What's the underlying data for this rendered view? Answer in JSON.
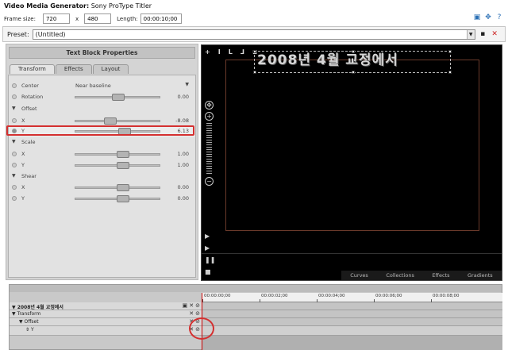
{
  "window": {
    "title_bold": "Video Media Generator:",
    "title_rest": " Sony ProType Titler"
  },
  "framebar": {
    "frame_size_label": "Frame size:",
    "width": "720",
    "x_label": "x",
    "height": "480",
    "length_label": "Length:",
    "length": "00:00:10;00"
  },
  "preset": {
    "label": "Preset:",
    "value": "(Untitled)"
  },
  "panel": {
    "title": "Text Block Properties",
    "tabs": [
      "Transform",
      "Effects",
      "Layout"
    ]
  },
  "props": {
    "center_label": "Center",
    "center_value": "Near baseline",
    "rotation_label": "Rotation",
    "rotation_value": "0.00",
    "offset_label": "Offset",
    "offset_x_label": "X",
    "offset_x_value": "-8.08",
    "offset_y_label": "Y",
    "offset_y_value": "6.13",
    "scale_label": "Scale",
    "scale_x_label": "X",
    "scale_x_value": "1.00",
    "scale_y_label": "Y",
    "scale_y_value": "1.00",
    "shear_label": "Shear",
    "shear_x_label": "X",
    "shear_x_value": "0.00",
    "shear_y_label": "Y",
    "shear_y_value": "0.00"
  },
  "preview": {
    "title_text": "2008년 4월 교정에서",
    "toolbar": [
      "+",
      "I",
      "L",
      "⅃",
      "⊔"
    ],
    "bottom_tabs": [
      "Curves",
      "Collections",
      "Effects",
      "Gradients"
    ]
  },
  "timeline": {
    "ruler": [
      "00:00:00;00",
      "00:00:02;00",
      "00:00:04;00",
      "00:00:06;00",
      "00:00:08;00"
    ],
    "rows": [
      {
        "label": "2008년 4월 교정에서"
      },
      {
        "label": "Transform"
      },
      {
        "label": "Offset"
      },
      {
        "label": "Y"
      }
    ]
  },
  "colors": {
    "highlight": "#d43030",
    "preview_bg": "#000000",
    "panel_bg": "#d4d4d4"
  }
}
